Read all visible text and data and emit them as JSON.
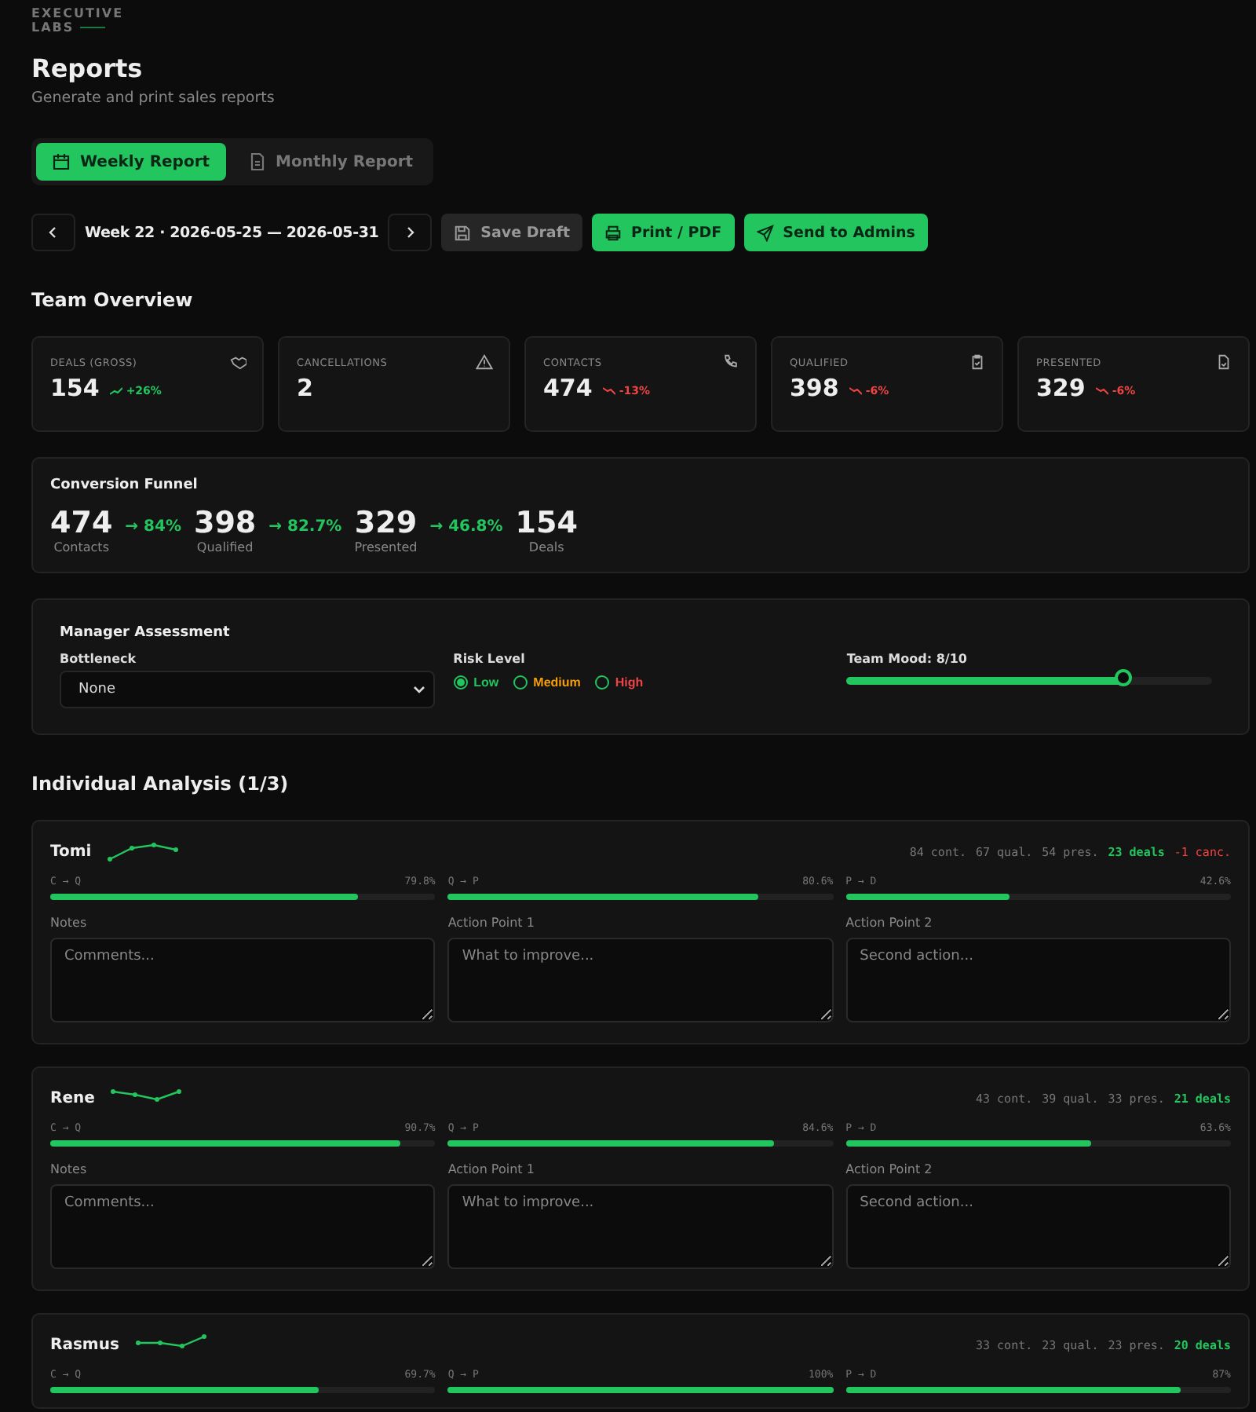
{
  "brand": {
    "line1": "EXECUTIVE",
    "line2": "LABS"
  },
  "header": {
    "title": "Reports",
    "subtitle": "Generate and print sales reports"
  },
  "tabs": [
    {
      "label": "Weekly Report",
      "selected": true
    },
    {
      "label": "Monthly Report",
      "selected": false
    }
  ],
  "toolbar": {
    "week": "Week 22 · 2026-05-25 — 2026-05-31",
    "save": "Save Draft",
    "print": "Print / PDF",
    "send": "Send to Admins"
  },
  "team_overview": {
    "title": "Team Overview",
    "kpis": [
      {
        "label": "DEALS (GROSS)",
        "value": "154",
        "change": "+26%",
        "kind": "up"
      },
      {
        "label": "CANCELLATIONS",
        "value": "2"
      },
      {
        "label": "CONTACTS",
        "value": "474",
        "change": "-13%",
        "kind": "down"
      },
      {
        "label": "QUALIFIED",
        "value": "398",
        "change": "-6%",
        "kind": "down"
      },
      {
        "label": "PRESENTED",
        "value": "329",
        "change": "-6%",
        "kind": "down"
      }
    ]
  },
  "funnel": {
    "title": "Conversion Funnel",
    "stages": [
      {
        "value": "474",
        "label": "Contacts",
        "rate": "→ 84%"
      },
      {
        "value": "398",
        "label": "Qualified",
        "rate": "→ 82.7%"
      },
      {
        "value": "329",
        "label": "Presented",
        "rate": "→ 46.8%"
      },
      {
        "value": "154",
        "label": "Deals"
      }
    ]
  },
  "assessment": {
    "title": "Manager Assessment",
    "bottleneck_label": "Bottleneck",
    "bottleneck_value": "None",
    "risk_label": "Risk Level",
    "risk_options": [
      {
        "label": "Low",
        "selected": true,
        "color": "#22c55e"
      },
      {
        "label": "Medium",
        "selected": false,
        "color": "#f59e0b"
      },
      {
        "label": "High",
        "selected": false,
        "color": "#ef4444"
      }
    ],
    "mood": {
      "label": "Team Mood: 8/10",
      "level": 0.76
    }
  },
  "individual": {
    "title": "Individual Analysis (1/3)",
    "people": [
      {
        "name": "Tomi",
        "stats": [
          {
            "text": "84 cont.",
            "kind": "plain"
          },
          {
            "text": "67 qual.",
            "kind": "plain"
          },
          {
            "text": "54 pres.",
            "kind": "plain"
          },
          {
            "text": "23 deals",
            "kind": "deals"
          },
          {
            "text": "-1 canc.",
            "kind": "canc"
          }
        ],
        "bars": [
          {
            "label": "C → Q",
            "reading": "79.8%",
            "level": 0.798
          },
          {
            "label": "Q → P",
            "reading": "80.6%",
            "level": 0.806
          },
          {
            "label": "P → D",
            "reading": "42.6%",
            "level": 0.426
          }
        ],
        "fields": [
          {
            "label": "Notes",
            "placeholder": "Comments..."
          },
          {
            "label": "Action Point 1",
            "placeholder": "What to improve..."
          },
          {
            "label": "Action Point 2",
            "placeholder": "Second action..."
          }
        ]
      },
      {
        "name": "Rene",
        "stats": [
          {
            "text": "43 cont.",
            "kind": "plain"
          },
          {
            "text": "39 qual.",
            "kind": "plain"
          },
          {
            "text": "33 pres.",
            "kind": "plain"
          },
          {
            "text": "21 deals",
            "kind": "deals"
          }
        ],
        "bars": [
          {
            "label": "C → Q",
            "reading": "90.7%",
            "level": 0.907
          },
          {
            "label": "Q → P",
            "reading": "84.6%",
            "level": 0.846
          },
          {
            "label": "P → D",
            "reading": "63.6%",
            "level": 0.636
          }
        ],
        "fields": [
          {
            "label": "Notes",
            "placeholder": "Comments..."
          },
          {
            "label": "Action Point 1",
            "placeholder": "What to improve..."
          },
          {
            "label": "Action Point 2",
            "placeholder": "Second action..."
          }
        ]
      },
      {
        "name": "Rasmus",
        "stats": [
          {
            "text": "33 cont.",
            "kind": "plain"
          },
          {
            "text": "23 qual.",
            "kind": "plain"
          },
          {
            "text": "23 pres.",
            "kind": "plain"
          },
          {
            "text": "20 deals",
            "kind": "deals"
          }
        ],
        "bars": [
          {
            "label": "C → Q",
            "reading": "69.7%",
            "level": 0.697
          },
          {
            "label": "Q → P",
            "reading": "100%",
            "level": 1
          },
          {
            "label": "P → D",
            "reading": "87%",
            "level": 0.87
          }
        ]
      }
    ]
  }
}
